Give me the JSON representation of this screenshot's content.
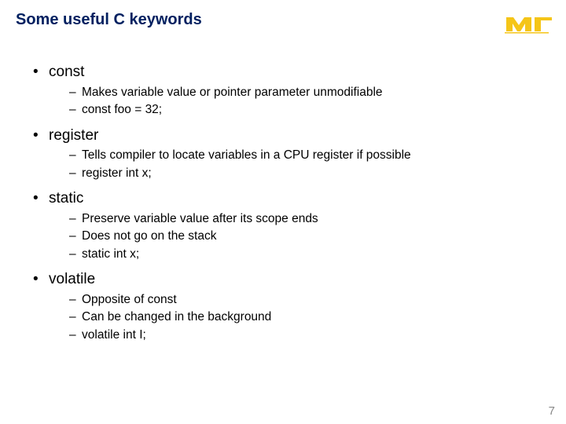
{
  "title": "Some useful C keywords",
  "items": [
    {
      "label": "const",
      "subs": [
        "Makes variable value or pointer parameter unmodifiable",
        "const foo = 32;"
      ]
    },
    {
      "label": "register",
      "subs": [
        "Tells compiler to locate variables in a CPU register if possible",
        "register int x;"
      ]
    },
    {
      "label": "static",
      "subs": [
        "Preserve variable value after its scope ends",
        "Does not go on the stack",
        "static int x;"
      ]
    },
    {
      "label": "volatile",
      "subs": [
        "Opposite of const",
        "Can be changed in the background",
        "volatile int I;"
      ]
    }
  ],
  "page_number": "7"
}
